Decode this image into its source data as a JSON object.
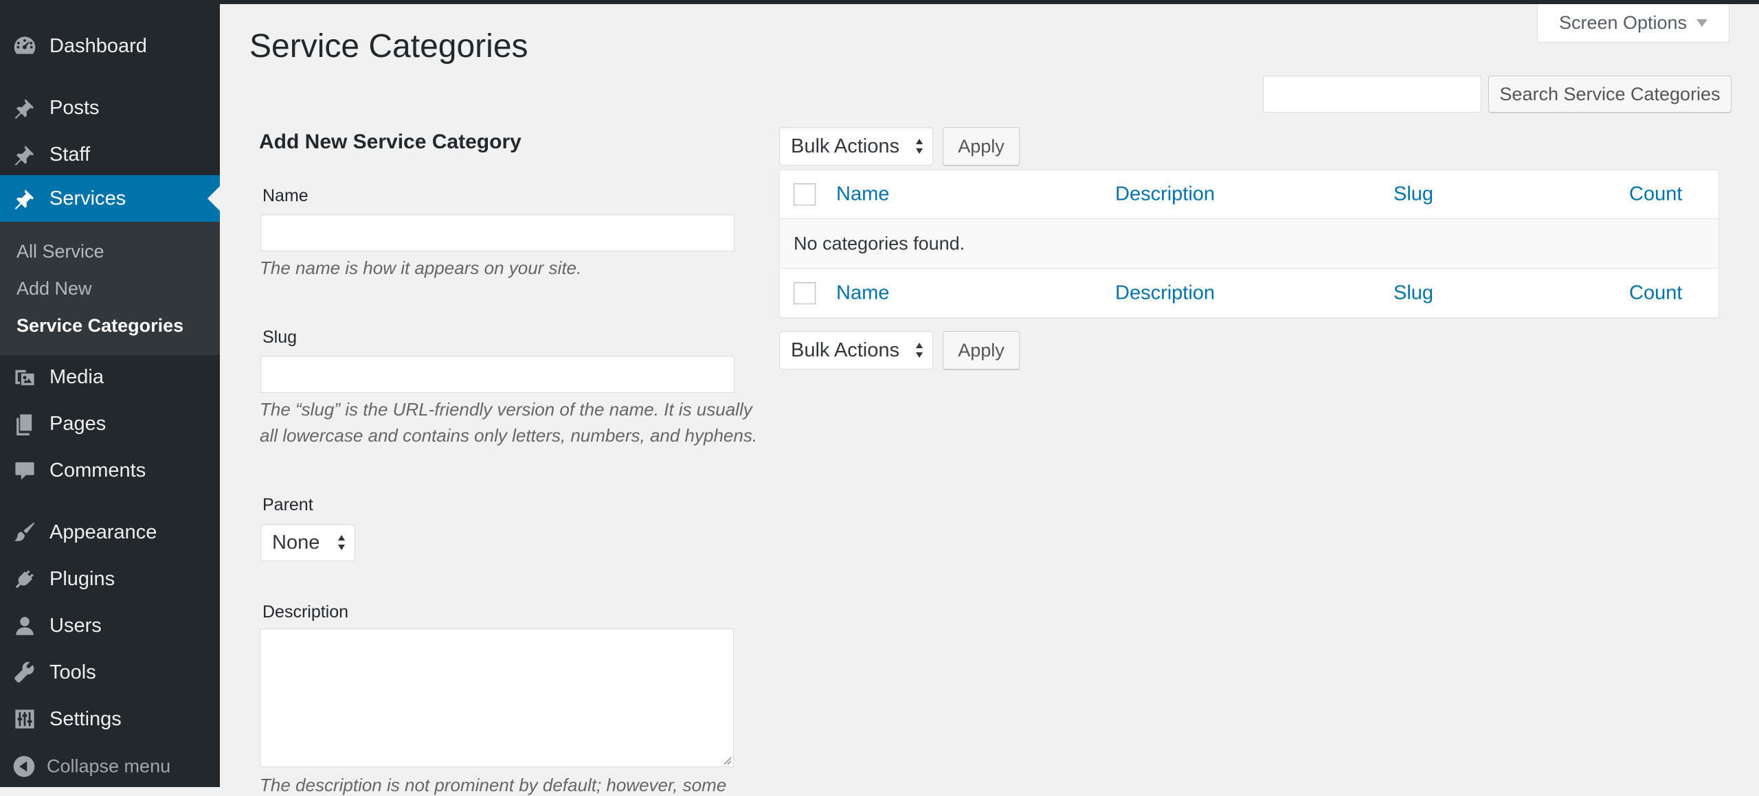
{
  "sidebar": {
    "items": [
      {
        "label": "Dashboard",
        "icon": "dashboard-icon"
      },
      {
        "label": "Posts",
        "icon": "pin-icon"
      },
      {
        "label": "Staff",
        "icon": "pin-icon"
      },
      {
        "label": "Services",
        "icon": "pin-icon"
      },
      {
        "label": "Media",
        "icon": "media-icon"
      },
      {
        "label": "Pages",
        "icon": "pages-icon"
      },
      {
        "label": "Comments",
        "icon": "comment-icon"
      },
      {
        "label": "Appearance",
        "icon": "brush-icon"
      },
      {
        "label": "Plugins",
        "icon": "plug-icon"
      },
      {
        "label": "Users",
        "icon": "user-icon"
      },
      {
        "label": "Tools",
        "icon": "wrench-icon"
      },
      {
        "label": "Settings",
        "icon": "sliders-icon"
      }
    ],
    "submenu": [
      "All Service",
      "Add New",
      "Service Categories"
    ],
    "collapse_label": "Collapse menu"
  },
  "header": {
    "title": "Service Categories",
    "screen_options": "Screen Options",
    "search_value": "",
    "search_button": "Search Service Categories"
  },
  "form": {
    "heading": "Add New Service Category",
    "name_label": "Name",
    "name_value": "",
    "name_hint": "The name is how it appears on your site.",
    "slug_label": "Slug",
    "slug_value": "",
    "slug_hint": "The “slug” is the URL-friendly version of the name. It is usually all lowercase and contains only letters, numbers, and hyphens.",
    "parent_label": "Parent",
    "parent_value": "None",
    "description_label": "Description",
    "description_value": "",
    "description_hint": "The description is not prominent by default; however, some"
  },
  "table": {
    "bulk_actions": "Bulk Actions",
    "apply": "Apply",
    "columns": [
      "Name",
      "Description",
      "Slug",
      "Count"
    ],
    "empty_message": "No categories found."
  },
  "colors": {
    "sidebar_bg": "#23282d",
    "submenu_bg": "#32373c",
    "accent": "#0073aa",
    "page_bg": "#f1f1f1",
    "link": "#0073aa"
  }
}
